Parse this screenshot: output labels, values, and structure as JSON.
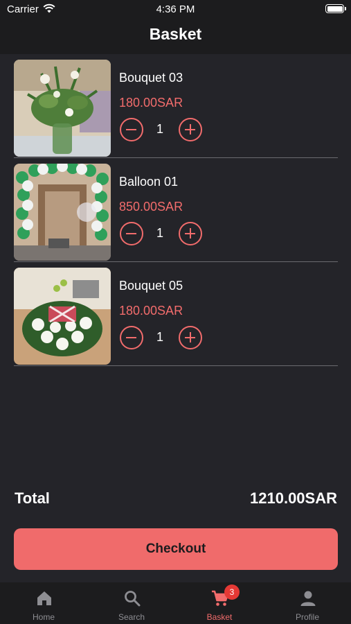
{
  "status_bar": {
    "carrier": "Carrier",
    "time": "4:36 PM"
  },
  "header": {
    "title": "Basket"
  },
  "items": [
    {
      "name": "Bouquet 03",
      "price": "180.00SAR",
      "quantity": "1"
    },
    {
      "name": "Balloon 01",
      "price": "850.00SAR",
      "quantity": "1"
    },
    {
      "name": "Bouquet 05",
      "price": "180.00SAR",
      "quantity": "1"
    }
  ],
  "summary": {
    "total_label": "Total",
    "total_value": "1210.00SAR"
  },
  "checkout": {
    "label": "Checkout"
  },
  "tabbar": {
    "tabs": [
      {
        "label": "Home",
        "icon": "home-icon",
        "active": false
      },
      {
        "label": "Search",
        "icon": "search-icon",
        "active": false
      },
      {
        "label": "Basket",
        "icon": "cart-icon",
        "active": true,
        "badge": "3"
      },
      {
        "label": "Profile",
        "icon": "person-icon",
        "active": false
      }
    ]
  },
  "colors": {
    "accent": "#f26c6c",
    "background": "#242429",
    "bar": "#1c1c1e",
    "badge": "#e53935"
  }
}
